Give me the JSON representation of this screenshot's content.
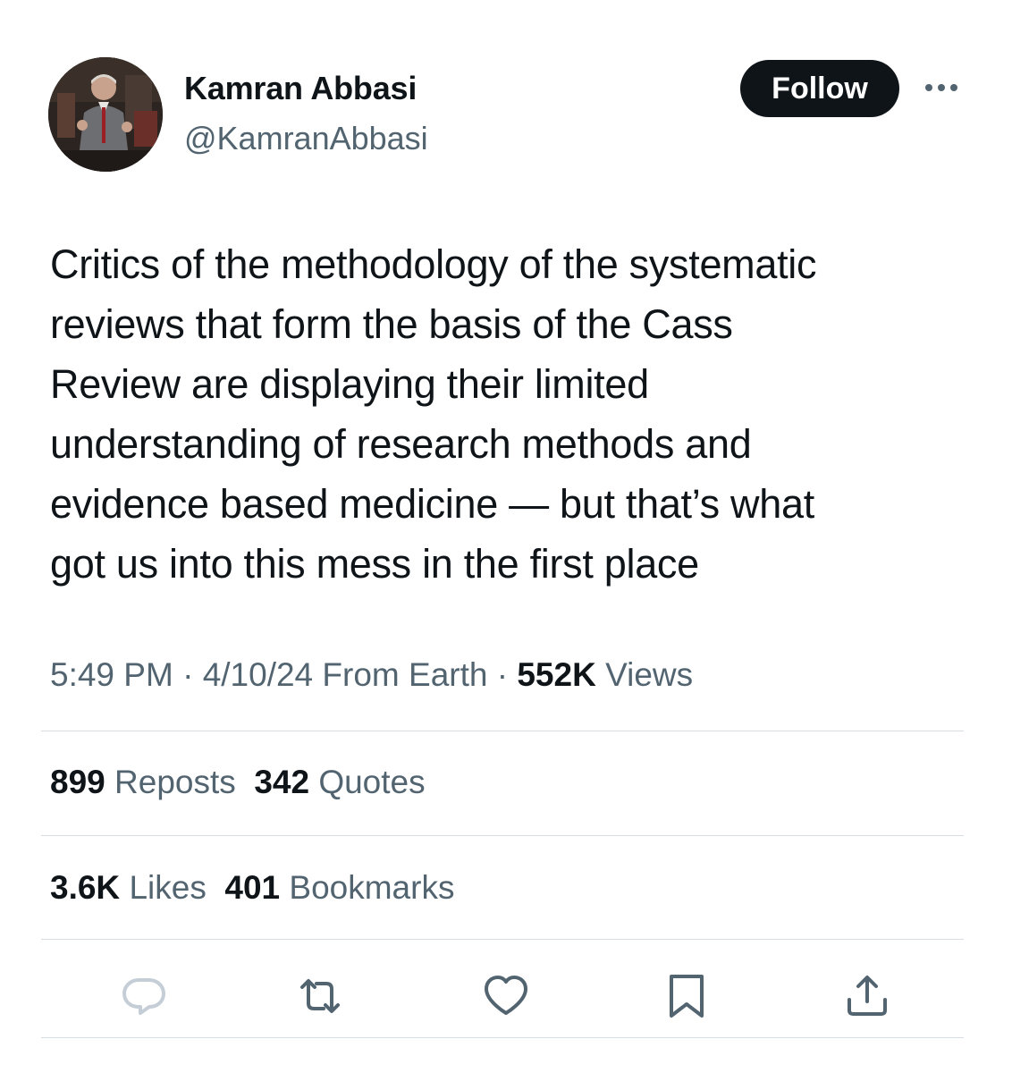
{
  "author": {
    "display_name": "Kamran Abbasi",
    "handle": "@KamranAbbasi",
    "avatar_icon": "profile-photo"
  },
  "header": {
    "follow_label": "Follow",
    "more_icon": "more-horizontal-icon"
  },
  "tweet": {
    "text_lines": [
      "Critics of the methodology of the systematic",
      "reviews that form the basis of the Cass",
      "Review are displaying their limited",
      "understanding of research methods and",
      "evidence based medicine — but that’s what",
      "got us into this mess in the first place"
    ]
  },
  "meta": {
    "time": "5:49 PM",
    "separator": "·",
    "date": "4/10/24",
    "source": "From Earth",
    "views_count": "552K",
    "views_label": "Views"
  },
  "stats": {
    "reposts_count": "899",
    "reposts_label": "Reposts",
    "quotes_count": "342",
    "quotes_label": "Quotes",
    "likes_count": "3.6K",
    "likes_label": "Likes",
    "bookmarks_count": "401",
    "bookmarks_label": "Bookmarks"
  },
  "actions": [
    "reply-icon",
    "repost-icon",
    "like-icon",
    "bookmark-icon",
    "share-icon"
  ],
  "colors": {
    "text": "#0f1419",
    "secondary": "#536471",
    "divider": "#d7dde2",
    "button_bg": "#0f1419",
    "icon": "#536471",
    "reply_icon_disabled": "#c5ced6"
  }
}
